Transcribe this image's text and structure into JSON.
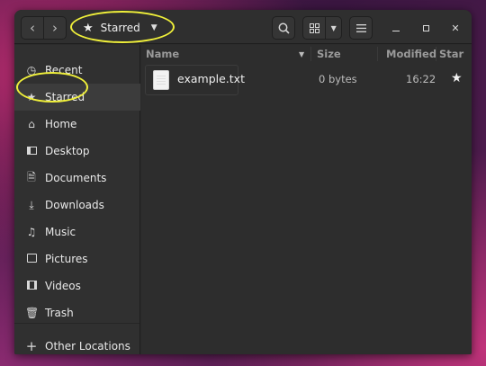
{
  "headerbar": {
    "back_icon": "chevron-left-icon",
    "forward_icon": "chevron-right-icon",
    "location": {
      "icon": "star-icon",
      "label": "Starred",
      "dropdown_icon": "triangle-down-icon"
    },
    "search_icon": "search-icon",
    "view_icon": "grid-view-icon",
    "view_dropdown_icon": "triangle-down-icon",
    "menu_icon": "hamburger-menu-icon",
    "window_controls": [
      "minimize-icon",
      "maximize-icon",
      "close-icon"
    ]
  },
  "sidebar": {
    "items": [
      {
        "label": "Recent",
        "icon": "clock-icon"
      },
      {
        "label": "Starred",
        "icon": "star-icon",
        "active": true
      },
      {
        "label": "Home",
        "icon": "home-icon"
      },
      {
        "label": "Desktop",
        "icon": "desktop-icon"
      },
      {
        "label": "Documents",
        "icon": "document-icon"
      },
      {
        "label": "Downloads",
        "icon": "download-icon"
      },
      {
        "label": "Music",
        "icon": "music-icon"
      },
      {
        "label": "Pictures",
        "icon": "picture-icon"
      },
      {
        "label": "Videos",
        "icon": "film-icon"
      },
      {
        "label": "Trash",
        "icon": "trash-icon"
      }
    ],
    "other_locations": {
      "label": "Other Locations",
      "icon": "plus-icon"
    }
  },
  "table": {
    "columns": {
      "name": "Name",
      "size": "Size",
      "modified": "Modified",
      "star": "Star"
    },
    "rows": [
      {
        "name": "example.txt",
        "size": "0 bytes",
        "modified": "16:22",
        "starred": true
      }
    ]
  },
  "colors": {
    "highlight_ring": "#f0f03a",
    "window_bg": "#2b2b2b",
    "sidebar_bg": "#303030"
  }
}
